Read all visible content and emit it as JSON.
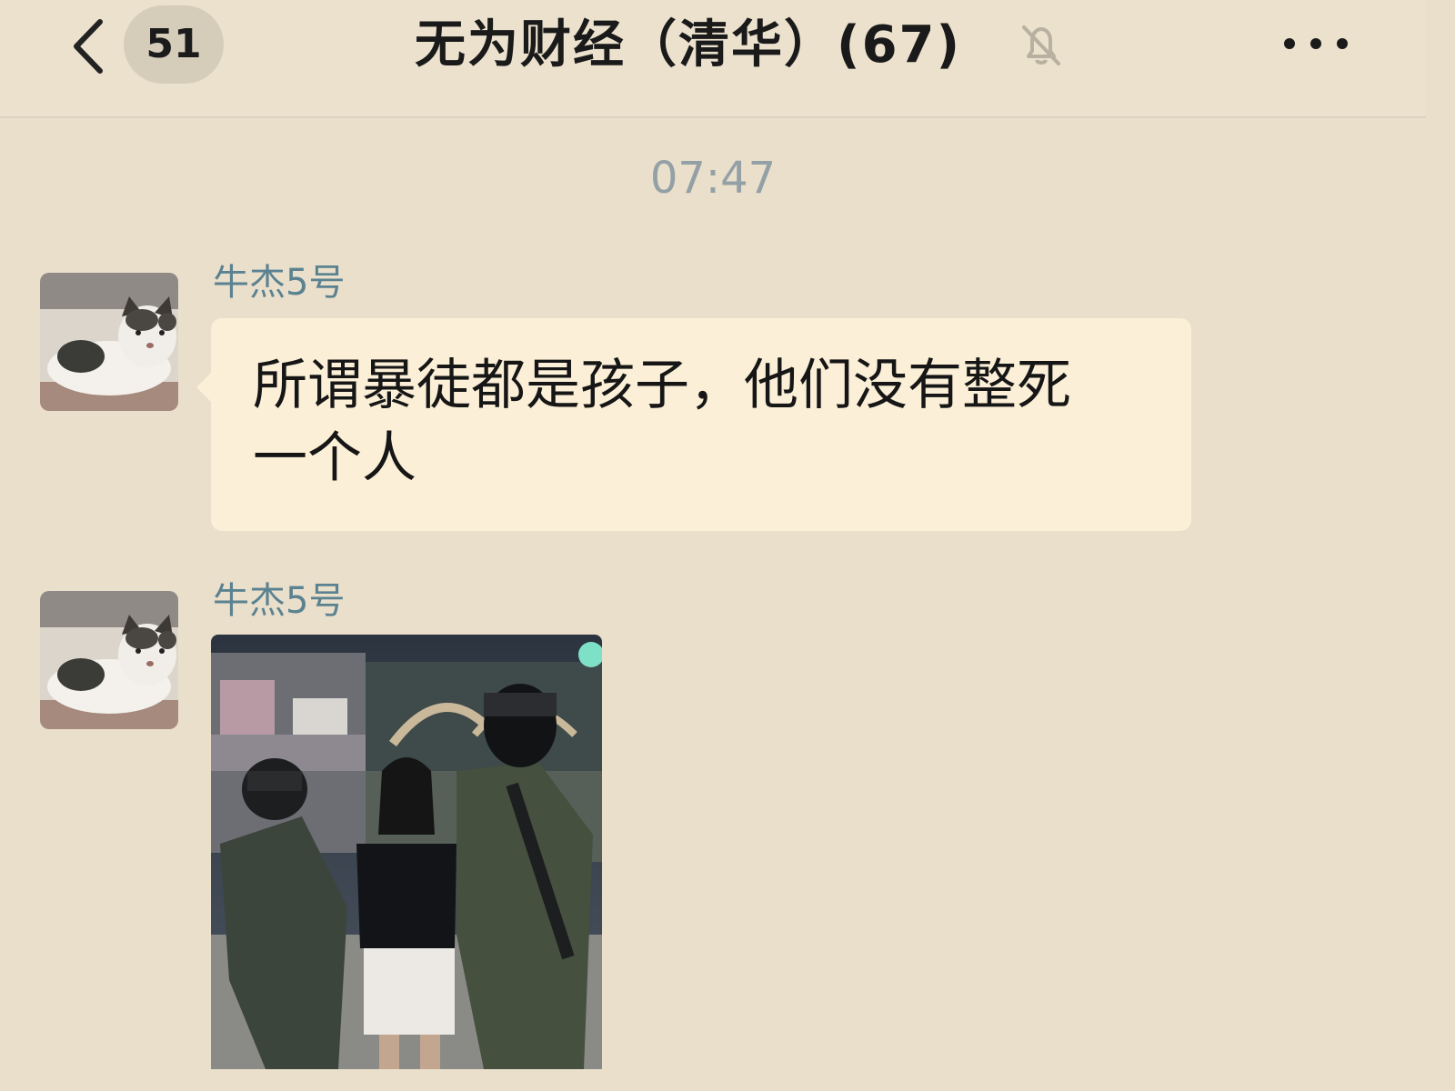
{
  "header": {
    "unread_count": "51",
    "title": "无为财经（清华）(67)",
    "back_icon": "chevron-left-icon",
    "mute_icon": "bell-off-icon",
    "more_icon": "more-dots-icon"
  },
  "chat": {
    "timestamp": "07:47",
    "messages": [
      {
        "sender": "牛杰5号",
        "type": "text",
        "text_line1": "所谓暴徒都是孩子，他们没有整死",
        "text_line2": "一个人"
      },
      {
        "sender": "牛杰5号",
        "type": "image",
        "image_desc": "photo-message"
      }
    ]
  },
  "colors": {
    "background": "#e9dfcb",
    "bubble": "#fbefd7",
    "sender_name": "#5b8291",
    "timestamp": "#93a0a5"
  }
}
